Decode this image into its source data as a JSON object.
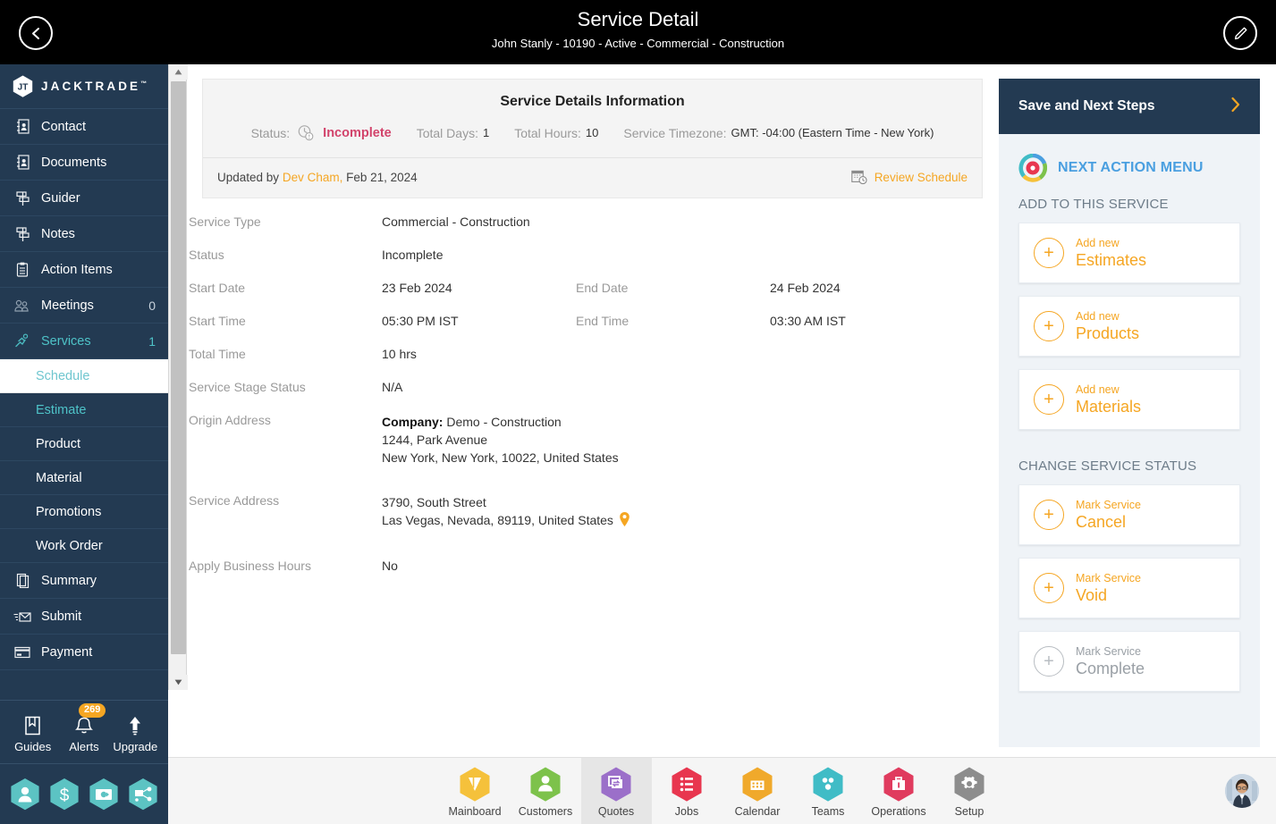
{
  "header": {
    "title": "Service Detail",
    "subtitle": "John Stanly - 10190 - Active - Commercial - Construction",
    "back_icon": "chevron-left-icon",
    "edit_icon": "pencil-icon"
  },
  "sidebar": {
    "brand": "JACKTRADE",
    "brand_tm": "™",
    "items": [
      {
        "label": "Contact",
        "icon": "contact-book-icon",
        "count": ""
      },
      {
        "label": "Documents",
        "icon": "document-icon",
        "count": ""
      },
      {
        "label": "Guider",
        "icon": "signpost-icon",
        "count": ""
      },
      {
        "label": "Notes",
        "icon": "signpost-icon",
        "count": ""
      },
      {
        "label": "Action Items",
        "icon": "clipboard-icon",
        "count": ""
      },
      {
        "label": "Meetings",
        "icon": "meetings-icon",
        "count": "0"
      },
      {
        "label": "Services",
        "icon": "services-icon",
        "count": "1"
      }
    ],
    "sub_items": [
      {
        "label": "Schedule",
        "state": "active"
      },
      {
        "label": "Estimate",
        "state": "teal"
      },
      {
        "label": "Product",
        "state": "normal"
      },
      {
        "label": "Material",
        "state": "normal"
      },
      {
        "label": "Promotions",
        "state": "normal"
      },
      {
        "label": "Work Order",
        "state": "normal"
      }
    ],
    "items_after": [
      {
        "label": "Summary",
        "icon": "summary-icon",
        "count": ""
      },
      {
        "label": "Submit",
        "icon": "submit-mail-icon",
        "count": ""
      },
      {
        "label": "Payment",
        "icon": "payment-card-icon",
        "count": ""
      }
    ],
    "footer": {
      "guides_label": "Guides",
      "alerts_label": "Alerts",
      "alerts_badge": "269",
      "upgrade_label": "Upgrade",
      "guides_icon": "book-icon",
      "alerts_icon": "bell-icon",
      "upgrade_icon": "upload-arrow-icon"
    },
    "quick_hexes": [
      {
        "icon": "person-hex-icon"
      },
      {
        "icon": "dollar-hex-icon"
      },
      {
        "icon": "money-exchange-hex-icon"
      },
      {
        "icon": "workflow-hex-icon"
      }
    ]
  },
  "info_card": {
    "title": "Service Details Information",
    "status_label": "Status:",
    "status_icon": "clock-icon",
    "status_value": "Incomplete",
    "total_days_label": "Total Days:",
    "total_days_value": "1",
    "total_hours_label": "Total Hours:",
    "total_hours_value": "10",
    "timezone_label": "Service Timezone:",
    "timezone_value": "GMT: -04:00 (Eastern Time - New York)",
    "updated_prefix": "Updated by",
    "updated_by": "Dev Cham,",
    "updated_date": "Feb 21, 2024",
    "review_schedule": "Review Schedule",
    "review_icon": "calendar-clock-icon"
  },
  "details": {
    "service_type_label": "Service Type",
    "service_type_value": "Commercial - Construction",
    "status_label": "Status",
    "status_value": "Incomplete",
    "start_date_label": "Start Date",
    "start_date_value": "23 Feb 2024",
    "end_date_label": "End Date",
    "end_date_value": "24 Feb 2024",
    "start_time_label": "Start Time",
    "start_time_value": "05:30 PM IST",
    "end_time_label": "End Time",
    "end_time_value": "03:30 AM IST",
    "total_time_label": "Total Time",
    "total_time_value": "10 hrs",
    "stage_status_label": "Service Stage Status",
    "stage_status_value": "N/A",
    "origin_address_label": "Origin Address",
    "origin_company_label": "Company:",
    "origin_company_value": "Demo - Construction",
    "origin_line1": "1244, Park Avenue",
    "origin_line2": "New York, New York, 10022, United States",
    "service_address_label": "Service Address",
    "service_line1": "3790, South Street",
    "service_line2": "Las Vegas, Nevada, 89119, United States",
    "map_pin_icon": "map-pin-icon",
    "business_hours_label": "Apply Business Hours",
    "business_hours_value": "No"
  },
  "right_panel": {
    "header_title": "Save and Next Steps",
    "header_chevron": "chevron-right-icon",
    "menu_title": "NEXT ACTION MENU",
    "menu_icon": "settings-cycle-icon",
    "section_add": "ADD TO THIS SERVICE",
    "add_cards": [
      {
        "top": "Add new",
        "bottom": "Estimates",
        "disabled": false
      },
      {
        "top": "Add new",
        "bottom": "Products",
        "disabled": false
      },
      {
        "top": "Add new",
        "bottom": "Materials",
        "disabled": false
      }
    ],
    "section_status": "CHANGE SERVICE STATUS",
    "status_cards": [
      {
        "top": "Mark Service",
        "bottom": "Cancel",
        "disabled": false
      },
      {
        "top": "Mark Service",
        "bottom": "Void",
        "disabled": false
      },
      {
        "top": "Mark Service",
        "bottom": "Complete",
        "disabled": true
      }
    ]
  },
  "bottom_bar": {
    "items": [
      {
        "label": "Mainboard",
        "icon": "mainboard-icon",
        "color": "#f5c13b",
        "active": false
      },
      {
        "label": "Customers",
        "icon": "customers-icon",
        "color": "#7dc24b",
        "active": false
      },
      {
        "label": "Quotes",
        "icon": "quotes-icon",
        "color": "#9b6fc9",
        "active": true
      },
      {
        "label": "Jobs",
        "icon": "jobs-icon",
        "color": "#e8364f",
        "active": false
      },
      {
        "label": "Calendar",
        "icon": "calendar-icon",
        "color": "#f0a92b",
        "active": false
      },
      {
        "label": "Teams",
        "icon": "teams-icon",
        "color": "#40bcc6",
        "active": false
      },
      {
        "label": "Operations",
        "icon": "operations-icon",
        "color": "#e03b5e",
        "active": false
      },
      {
        "label": "Setup",
        "icon": "setup-gear-icon",
        "color": "#8d8d8d",
        "active": false
      }
    ],
    "avatar_icon": "user-avatar"
  },
  "colors": {
    "sidebar_bg": "#233a52",
    "accent_orange": "#f5a623",
    "accent_teal": "#4ec3c8",
    "status_red": "#d2436b",
    "panel_bg": "#eff3f7",
    "menu_blue": "#4a9fe0"
  }
}
